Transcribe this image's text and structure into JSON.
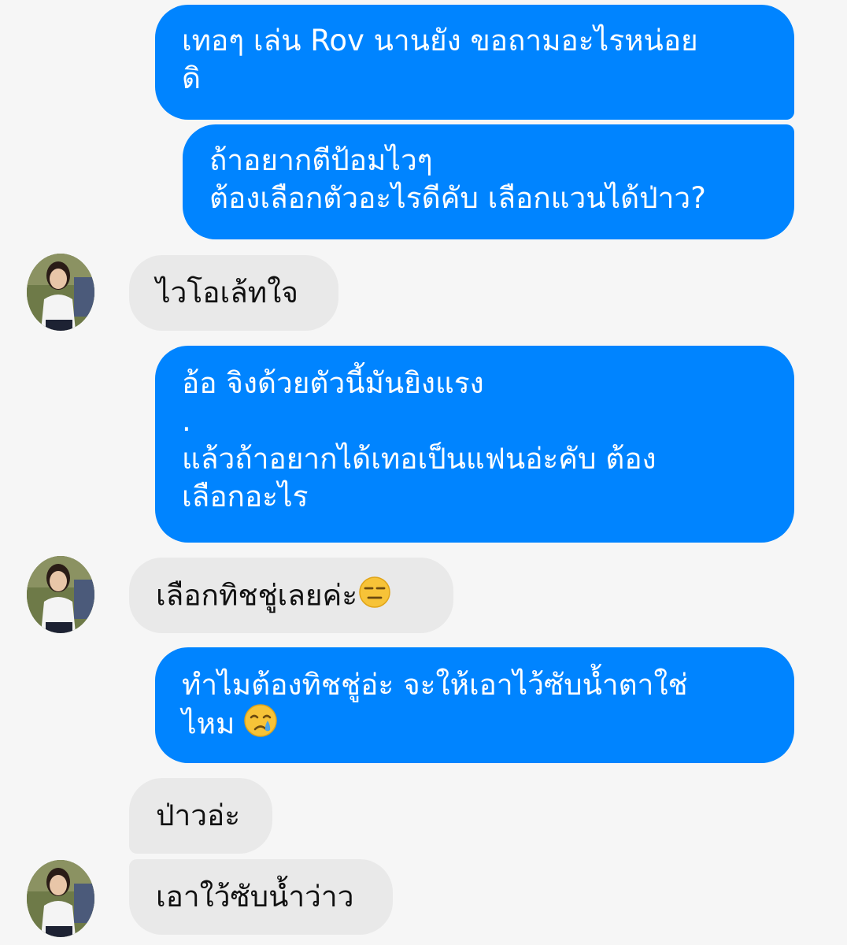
{
  "conversation": {
    "messages": [
      {
        "sender": "me",
        "text": "เทอๆ เล่น Rov นานยัง ขอถามอะไรหน่อย\nดิ"
      },
      {
        "sender": "me",
        "text": "ถ้าอยากตีป้อมไวๆ\nต้องเลือกตัวอะไรดีคับ เลือกแวนได้ป่าว?"
      },
      {
        "sender": "them",
        "text": "ไวโอเล้ทใจ"
      },
      {
        "sender": "me",
        "text": "อ้อ จิงด้วยตัวนี้มันยิงแรง\n.\nแล้วถ้าอยากได้เทอเป็นแฟนอ่ะคับ ต้อง\nเลือกอะไร"
      },
      {
        "sender": "them",
        "text": "เลือกทิชชู่เลยค่ะ",
        "emoji": "expressionless-face-icon"
      },
      {
        "sender": "me",
        "text": "ทำไมต้องทิชชู่อ่ะ จะให้เอาไว้ซับน้ำตาใช่\nไหม ",
        "emoji": "crying-face-icon"
      },
      {
        "sender": "them",
        "text": "ป่าวอ่ะ"
      },
      {
        "sender": "them",
        "text": "เอาใว้ซับน้ำว่าว"
      }
    ]
  },
  "colors": {
    "outgoing_bubble": "#0084ff",
    "incoming_bubble": "#e9e9e9",
    "background": "#f6f6f6"
  }
}
